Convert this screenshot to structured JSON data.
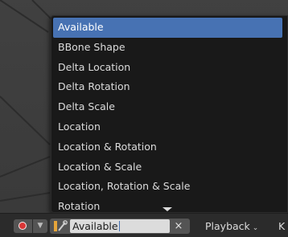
{
  "dropdown": {
    "items": [
      {
        "label": "Available",
        "active": true
      },
      {
        "label": "BBone Shape"
      },
      {
        "label": "Delta Location"
      },
      {
        "label": "Delta Rotation"
      },
      {
        "label": "Delta Scale"
      },
      {
        "label": "Location"
      },
      {
        "label": "Location & Rotation"
      },
      {
        "label": "Location & Scale"
      },
      {
        "label": "Location, Rotation & Scale"
      },
      {
        "label": "Rotation"
      }
    ]
  },
  "timeline": {
    "keying_set_value": "Available",
    "clear_glyph": "×",
    "playback_label": "Playback",
    "keying_label": "K",
    "chevron_glyph": "⌄",
    "record_icon": "record-dot-icon",
    "keying_set_icon": "key-icon"
  },
  "colors": {
    "accent": "#4772b3",
    "menu_bg": "#191919",
    "record": "#d93636"
  }
}
